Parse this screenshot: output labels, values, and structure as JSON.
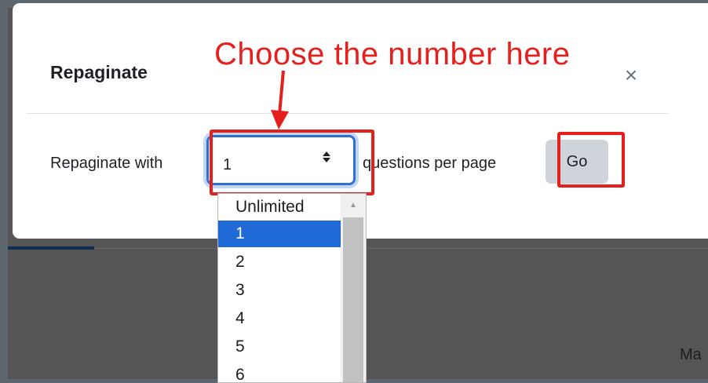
{
  "modal": {
    "title": "Repaginate",
    "close_glyph": "×",
    "label_before": "Repaginate with",
    "select_value": "1",
    "select_caret": "◆",
    "label_after": "questions per page",
    "go_label": "Go"
  },
  "dropdown": {
    "options": [
      "Unlimited",
      "1",
      "2",
      "3",
      "4",
      "5",
      "6"
    ],
    "selected": "1"
  },
  "annotation": {
    "text": "Choose the number here",
    "color": "#e5201c"
  },
  "background": {
    "partial_text": "Ma"
  },
  "colors": {
    "accent": "#1f6ad6",
    "go_button": "#ced4da",
    "overlay": "#555555"
  }
}
